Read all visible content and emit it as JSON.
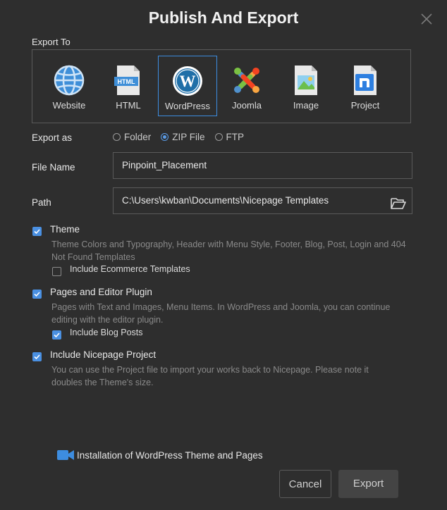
{
  "dialog": {
    "title": "Publish And Export",
    "export_to_label": "Export To",
    "targets": [
      {
        "label": "Website",
        "icon": "globe-icon"
      },
      {
        "label": "HTML",
        "icon": "html-file-icon"
      },
      {
        "label": "WordPress",
        "icon": "wordpress-icon"
      },
      {
        "label": "Joomla",
        "icon": "joomla-icon"
      },
      {
        "label": "Image",
        "icon": "image-file-icon"
      },
      {
        "label": "Project",
        "icon": "nicepage-project-icon"
      }
    ],
    "selected_target": "WordPress",
    "export_as": {
      "label": "Export as",
      "options": [
        "Folder",
        "ZIP File",
        "FTP"
      ],
      "selected": "ZIP File"
    },
    "file_name": {
      "label": "File Name",
      "value": "Pinpoint_Placement"
    },
    "path": {
      "label": "Path",
      "value": "C:\\Users\\kwban\\Documents\\Nicepage Templates"
    },
    "options": [
      {
        "title": "Theme",
        "checked": true,
        "description": "Theme Colors and Typography, Header with Menu Style, Footer, Blog, Post, Login and 404 Not Found Templates",
        "sub": {
          "label": "Include Ecommerce Templates",
          "checked": false
        }
      },
      {
        "title": "Pages and Editor Plugin",
        "checked": true,
        "description": "Pages with Text and Images, Menu Items. In WordPress and Joomla, you can continue editing with the editor plugin.",
        "sub": {
          "label": "Include Blog Posts",
          "checked": true
        }
      },
      {
        "title": "Include Nicepage Project",
        "checked": true,
        "description": "You can use the Project file to import your works back to Nicepage. Please note it doubles the Theme's size."
      }
    ],
    "install_link": "Installation of WordPress Theme and Pages",
    "cancel_label": "Cancel",
    "export_label": "Export"
  },
  "colors": {
    "background": "#2e2e2e",
    "accent": "#4a90e2",
    "selection_border": "#3d8de0",
    "video_icon": "#3d8de0"
  }
}
